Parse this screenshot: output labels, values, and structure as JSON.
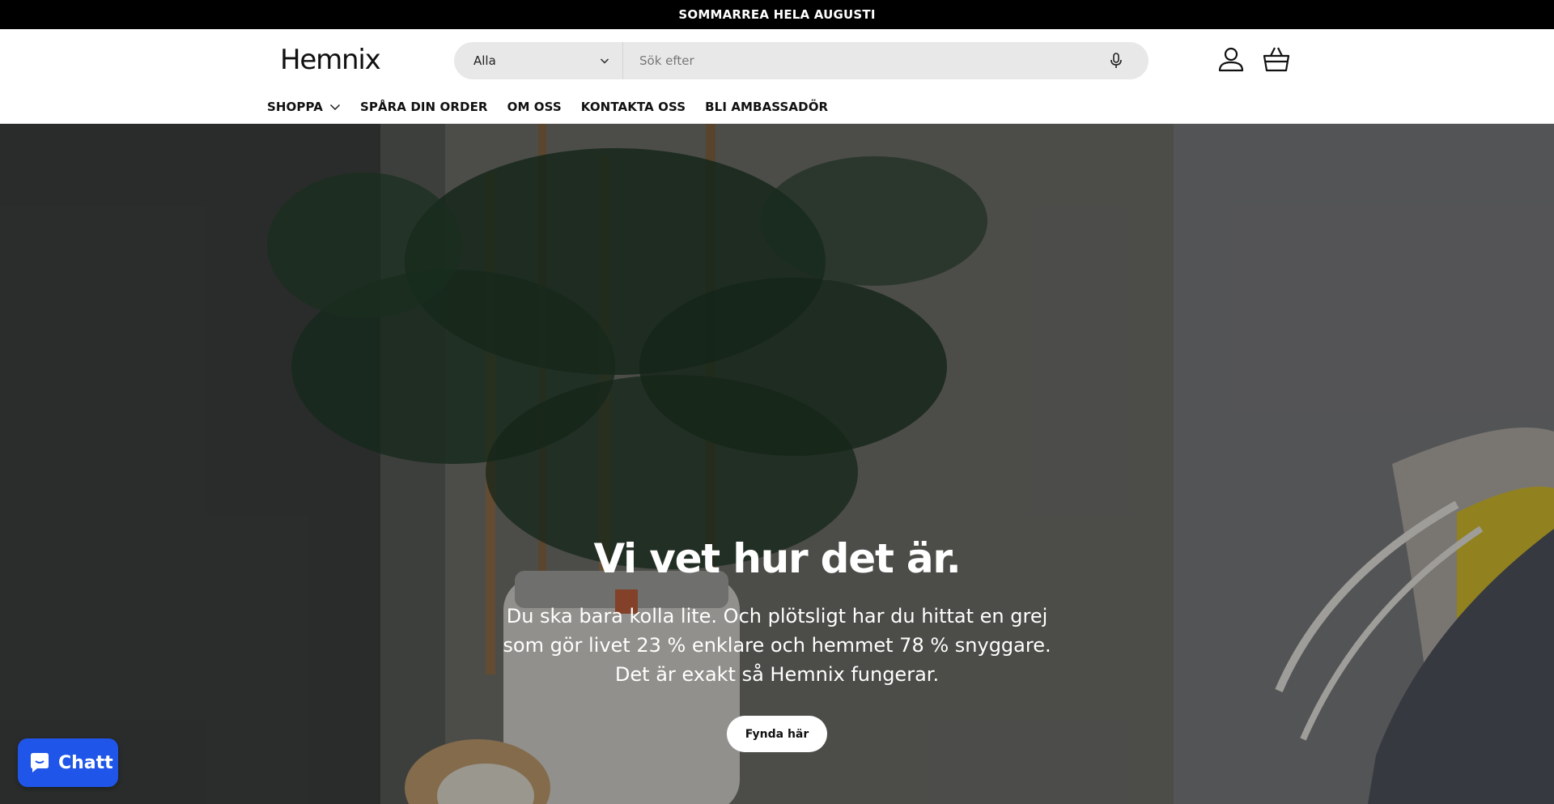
{
  "announcement": {
    "text": "SOMMARREA HELA AUGUSTI"
  },
  "header": {
    "logo": "Hemnix",
    "search": {
      "category": "Alla",
      "placeholder": "Sök efter"
    },
    "icons": {
      "account": "user-icon",
      "cart": "basket-icon",
      "mic": "microphone-icon"
    }
  },
  "nav": {
    "items": [
      {
        "label": "SHOPPA",
        "has_dropdown": true
      },
      {
        "label": "SPÅRA DIN ORDER"
      },
      {
        "label": "OM OSS"
      },
      {
        "label": "KONTAKTA OSS"
      },
      {
        "label": "BLI AMBASSADÖR"
      }
    ]
  },
  "hero": {
    "title": "Vi vet hur det är.",
    "text_lines": [
      "Du ska bara kolla lite. Och plötsligt har du hittat en grej",
      "som gör livet 23 % enklare och hemmet 78 % snyggare.",
      "Det är exakt så Hemnix fungerar."
    ],
    "button": "Fynda här"
  },
  "chat": {
    "label": "Chatt"
  },
  "colors": {
    "announce_bg": "#000000",
    "chat_bg": "#1f55e8",
    "search_bg": "#e8e8e8"
  }
}
